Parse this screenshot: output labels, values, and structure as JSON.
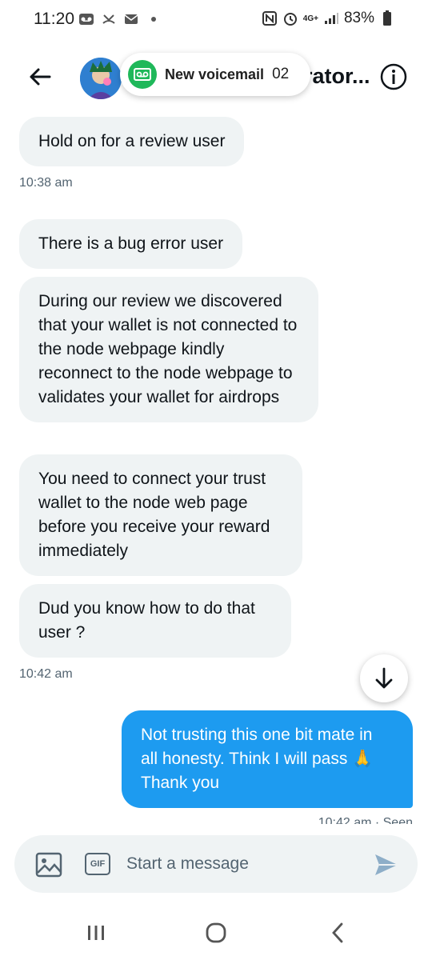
{
  "status_bar": {
    "time": "11:20",
    "network": "4G+",
    "battery": "83%"
  },
  "header": {
    "name": "rator...",
    "back_icon": "arrow-left-icon",
    "info_icon": "info-icon"
  },
  "toast": {
    "label": "New voicemail",
    "count": "02",
    "icon": "voicemail-icon"
  },
  "messages": [
    {
      "direction": "in",
      "text": "Hold on for a review user"
    },
    {
      "direction": "in",
      "text": "There is a bug error user"
    },
    {
      "direction": "in",
      "text": "During our review we discovered that your wallet is not connected to the node webpage kindly reconnect to the node webpage to validates your wallet for airdrops"
    },
    {
      "direction": "in",
      "text": "You need to connect your trust wallet to the node web page before you receive your reward immediately"
    },
    {
      "direction": "in",
      "text": "Dud you know how to do that user ?"
    },
    {
      "direction": "out",
      "text": "Not trusting this one bit mate in all honesty. Think I will pass 🙏 Thank you"
    }
  ],
  "timestamps": {
    "first": "10:38 am",
    "second": "10:42 am",
    "outgoing": "10:42 am · Seen"
  },
  "composer": {
    "placeholder": "Start a message",
    "gif_label": "GIF"
  },
  "colors": {
    "accent": "#1d9bf0",
    "bubble_in": "#eff3f4",
    "voicemail": "#1fb85a"
  }
}
